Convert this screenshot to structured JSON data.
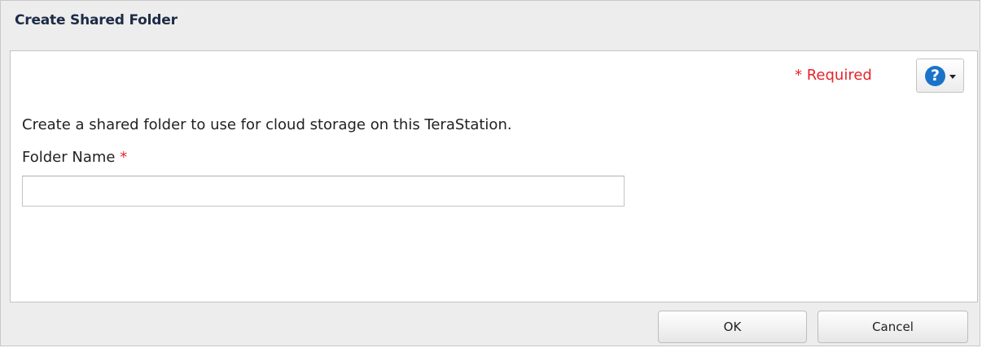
{
  "dialog": {
    "title": "Create Shared Folder"
  },
  "header": {
    "required_star": "*",
    "required_label": "Required",
    "help_glyph": "?",
    "help_icon": "question-circle-icon"
  },
  "form": {
    "description": "Create a shared folder to use for cloud storage on this TeraStation.",
    "folder_name_label": "Folder Name",
    "folder_name_star": "*",
    "folder_name_value": ""
  },
  "buttons": {
    "ok_label": "OK",
    "cancel_label": "Cancel"
  },
  "colors": {
    "required": "#e8232a",
    "help_icon": "#1a73c9",
    "title": "#1d2b46"
  }
}
